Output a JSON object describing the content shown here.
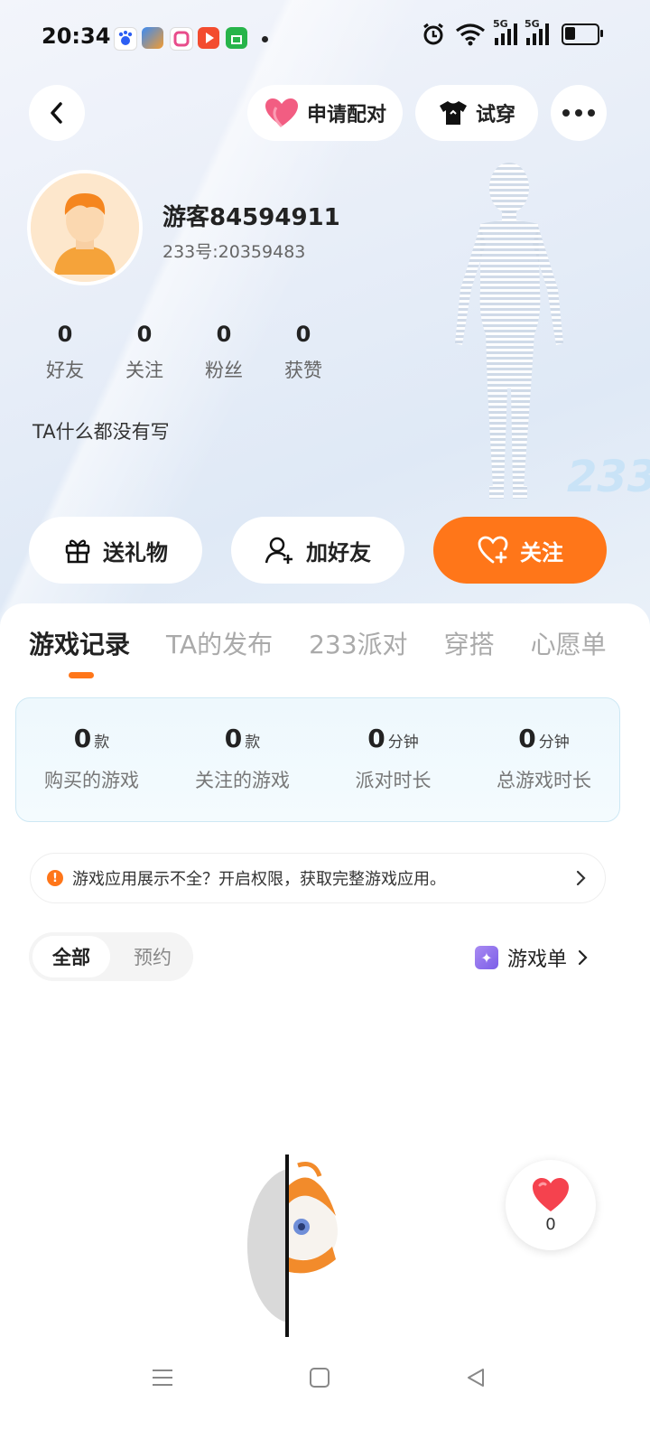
{
  "status_bar": {
    "time": "20:34",
    "net1": "5G",
    "net2": "5G"
  },
  "top_actions": {
    "pair_label": "申请配对",
    "tryon_label": "试穿"
  },
  "profile": {
    "username": "游客84594911",
    "uid": "233号:20359483",
    "bio": "TA什么都没有写",
    "stats": [
      {
        "value": "0",
        "label": "好友"
      },
      {
        "value": "0",
        "label": "关注"
      },
      {
        "value": "0",
        "label": "粉丝"
      },
      {
        "value": "0",
        "label": "获赞"
      }
    ],
    "badge": "233"
  },
  "actions": {
    "gift": "送礼物",
    "add_friend": "加好友",
    "follow": "关注"
  },
  "tabs": [
    {
      "label": "游戏记录",
      "active": true
    },
    {
      "label": "TA的发布",
      "active": false
    },
    {
      "label": "233派对",
      "active": false
    },
    {
      "label": "穿搭",
      "active": false
    },
    {
      "label": "心愿单",
      "active": false
    }
  ],
  "summary": [
    {
      "value": "0",
      "unit": "款",
      "label": "购买的游戏"
    },
    {
      "value": "0",
      "unit": "款",
      "label": "关注的游戏"
    },
    {
      "value": "0",
      "unit": "分钟",
      "label": "派对时长"
    },
    {
      "value": "0",
      "unit": "分钟",
      "label": "总游戏时长"
    }
  ],
  "notice": {
    "text": "游戏应用展示不全？开启权限，获取完整游戏应用。"
  },
  "filter": {
    "all": "全部",
    "reserve": "预约"
  },
  "gamelist": {
    "label": "游戏单"
  },
  "like": {
    "count": "0"
  },
  "colors": {
    "accent": "#ff7619",
    "like": "#f5424e"
  }
}
